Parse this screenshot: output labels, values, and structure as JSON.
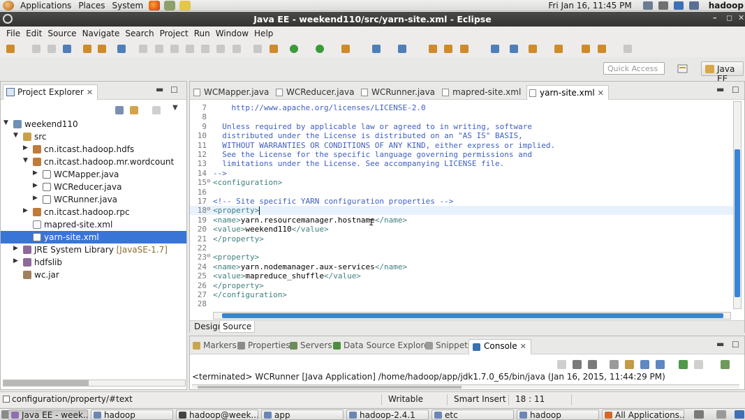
{
  "top_panel": {
    "menus": [
      "Applications",
      "Places",
      "System"
    ],
    "clock": "Fri Jan 16, 11:45 PM",
    "user": "hadoop"
  },
  "window": {
    "title": "Java EE - weekend110/src/yarn-site.xml - Eclipse"
  },
  "menu_bar": [
    "File",
    "Edit",
    "Source",
    "Navigate",
    "Search",
    "Project",
    "Run",
    "Window",
    "Help"
  ],
  "quick_access": {
    "placeholder": "Quick Access"
  },
  "perspective": {
    "label": "Java EE"
  },
  "project_explorer": {
    "title": "Project Explorer",
    "tree": [
      {
        "label": "weekend110",
        "icon": "project-icon",
        "twisty": "▼"
      },
      {
        "label": "src",
        "icon": "source-folder-icon",
        "twisty": "▼"
      },
      {
        "label": "cn.itcast.hadoop.hdfs",
        "icon": "package-icon",
        "twisty": "▶"
      },
      {
        "label": "cn.itcast.hadoop.mr.wordcount",
        "icon": "package-icon",
        "twisty": "▼"
      },
      {
        "label": "WCMapper.java",
        "icon": "java-file-icon",
        "twisty": "▶"
      },
      {
        "label": "WCReducer.java",
        "icon": "java-file-icon",
        "twisty": "▶"
      },
      {
        "label": "WCRunner.java",
        "icon": "java-file-icon",
        "twisty": "▶"
      },
      {
        "label": "cn.itcast.hadoop.rpc",
        "icon": "package-icon",
        "twisty": "▶"
      },
      {
        "label": "mapred-site.xml",
        "icon": "xml-file-icon",
        "twisty": ""
      },
      {
        "label": "yarn-site.xml",
        "icon": "xml-file-icon",
        "twisty": "",
        "selected": true
      },
      {
        "label": "JRE System Library",
        "sub": "[JavaSE-1.7]",
        "icon": "library-icon",
        "twisty": "▶"
      },
      {
        "label": "hdfslib",
        "icon": "library-icon",
        "twisty": "▶"
      },
      {
        "label": "wc.jar",
        "icon": "jar-icon",
        "twisty": ""
      }
    ]
  },
  "editor": {
    "tabs": [
      {
        "label": "WCMapper.java"
      },
      {
        "label": "WCReducer.java"
      },
      {
        "label": "WCRunner.java"
      },
      {
        "label": "mapred-site.xml"
      },
      {
        "label": "yarn-site.xml",
        "active": true
      }
    ],
    "lines": [
      {
        "n": "7",
        "fold": "",
        "text": "    http://www.apache.org/licenses/LICENSE-2.0",
        "kind": "cmt"
      },
      {
        "n": "8",
        "fold": "",
        "text": "",
        "kind": "cmt"
      },
      {
        "n": "9",
        "fold": "",
        "text": "  Unless required by applicable law or agreed to in writing, software",
        "kind": "cmt"
      },
      {
        "n": "10",
        "fold": "",
        "text": "  distributed under the License is distributed on an \"AS IS\" BASIS,",
        "kind": "cmt"
      },
      {
        "n": "11",
        "fold": "",
        "text": "  WITHOUT WARRANTIES OR CONDITIONS OF ANY KIND, either express or implied.",
        "kind": "cmt"
      },
      {
        "n": "12",
        "fold": "",
        "text": "  See the License for the specific language governing permissions and",
        "kind": "cmt"
      },
      {
        "n": "13",
        "fold": "",
        "text": "  limitations under the License. See accompanying LICENSE file.",
        "kind": "cmt"
      },
      {
        "n": "14",
        "fold": "",
        "text": "-->",
        "kind": "cmt"
      },
      {
        "n": "15",
        "fold": "⊖",
        "text": "<configuration>",
        "kind": "tag"
      },
      {
        "n": "16",
        "fold": "",
        "text": "",
        "kind": "tag"
      },
      {
        "n": "17",
        "fold": "",
        "text": "<!-- Site specific YARN configuration properties -->",
        "kind": "cmt"
      },
      {
        "n": "18",
        "fold": "⊖",
        "text": "<property>",
        "kind": "tag",
        "current": true
      },
      {
        "n": "19",
        "fold": "",
        "text": "<name>yarn.resourcemanager.hostname</name>",
        "kind": "mixed"
      },
      {
        "n": "20",
        "fold": "",
        "text": "<value>weekend110</value>",
        "kind": "mixed"
      },
      {
        "n": "21",
        "fold": "",
        "text": "</property>",
        "kind": "tag"
      },
      {
        "n": "22",
        "fold": "",
        "text": "",
        "kind": "tag"
      },
      {
        "n": "23",
        "fold": "⊖",
        "text": "<property>",
        "kind": "tag"
      },
      {
        "n": "24",
        "fold": "",
        "text": "<name>yarn.nodemanager.aux-services</name>",
        "kind": "mixed"
      },
      {
        "n": "25",
        "fold": "",
        "text": "<value>mapreduce_shuffle</value>",
        "kind": "mixed"
      },
      {
        "n": "26",
        "fold": "",
        "text": "</property>",
        "kind": "tag"
      },
      {
        "n": "27",
        "fold": "",
        "text": "</configuration>",
        "kind": "tag"
      },
      {
        "n": "28",
        "fold": "",
        "text": "",
        "kind": "tag"
      }
    ],
    "subtabs": [
      "Design",
      "Source"
    ]
  },
  "bottom_panel": {
    "tabs": [
      "Markers",
      "Properties",
      "Servers",
      "Data Source Explorer",
      "Snippets",
      "Console"
    ],
    "console_text": "<terminated> WCRunner [Java Application] /home/hadoop/app/jdk1.7.0_65/bin/java (Jan 16, 2015, 11:44:29 PM)"
  },
  "status_bar": {
    "path": "configuration/property/#text",
    "mode": "Writable",
    "insert": "Smart Insert",
    "position": "18 : 11"
  },
  "taskbar": [
    {
      "label": "Java EE - week...",
      "active": true
    },
    {
      "label": "hadoop"
    },
    {
      "label": "hadoop@week..."
    },
    {
      "label": "app"
    },
    {
      "label": "hadoop-2.4.1"
    },
    {
      "label": "etc"
    },
    {
      "label": "hadoop"
    },
    {
      "label": "All Applications..."
    }
  ]
}
